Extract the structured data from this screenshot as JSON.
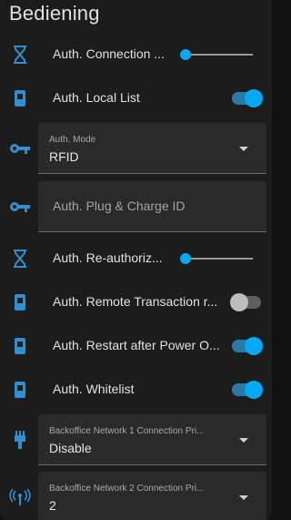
{
  "card_title": "Bediening",
  "colors": {
    "accent": "#03a9f4",
    "icon": "#2f8fd0",
    "background": "#1c1c1c"
  },
  "rows": [
    {
      "type": "slider",
      "icon": "hourglass-icon",
      "label": "Auth. Connection ...",
      "value_fraction": 0.05
    },
    {
      "type": "toggle",
      "icon": "sim-card-icon",
      "label": "Auth. Local List",
      "state": "on"
    },
    {
      "type": "select",
      "icon": "key-icon",
      "field_label": "Auth. Mode",
      "value": "RFID"
    },
    {
      "type": "text",
      "icon": "key-icon",
      "placeholder": "Auth. Plug & Charge ID"
    },
    {
      "type": "slider",
      "icon": "hourglass-icon",
      "label": "Auth. Re-authoriz...",
      "value_fraction": 0.05
    },
    {
      "type": "toggle",
      "icon": "sim-card-icon",
      "label": "Auth. Remote Transaction r...",
      "state": "off"
    },
    {
      "type": "toggle",
      "icon": "sim-card-icon",
      "label": "Auth. Restart after Power O...",
      "state": "on"
    },
    {
      "type": "toggle",
      "icon": "sim-card-icon",
      "label": "Auth. Whitelist",
      "state": "on"
    },
    {
      "type": "select",
      "icon": "ethernet-icon",
      "field_label": "Backoffice Network 1 Connection Pri...",
      "value": "Disable"
    },
    {
      "type": "select",
      "icon": "antenna-icon",
      "field_label": "Backoffice Network 2 Connection Pri...",
      "value": "2"
    }
  ]
}
